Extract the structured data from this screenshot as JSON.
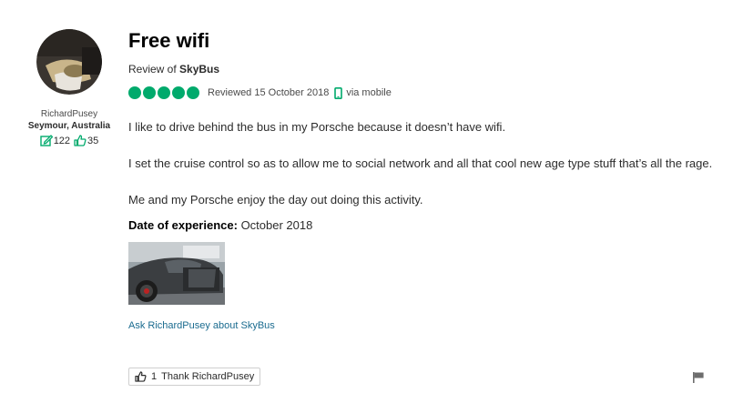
{
  "profile": {
    "username": "RichardPusey",
    "location": "Seymour, Australia",
    "contributions": "122",
    "helpful_votes": "35",
    "avatar_icon": "user-avatar"
  },
  "review": {
    "title": "Free wifi",
    "review_of_prefix": "Review of",
    "business": "SkyBus",
    "rating": 5,
    "rating_max": 5,
    "reviewed_date": "Reviewed 15 October 2018",
    "device": "via mobile",
    "paragraphs": [
      "I like to drive behind the bus in my Porsche because it doesn’t have wifi.",
      "I set the cruise control so as to allow me to social network and all that cool new age type stuff that’s all the rage.",
      "Me and my Porsche enjoy the day out doing this activity."
    ],
    "date_of_experience_label": "Date of experience:",
    "date_of_experience": "October 2018",
    "ask_link": "Ask RichardPusey about SkyBus",
    "thank_count": "1",
    "thank_label": "Thank RichardPusey"
  },
  "colors": {
    "accent_green": "#00aa6c",
    "link_blue": "#1a6b8f"
  }
}
